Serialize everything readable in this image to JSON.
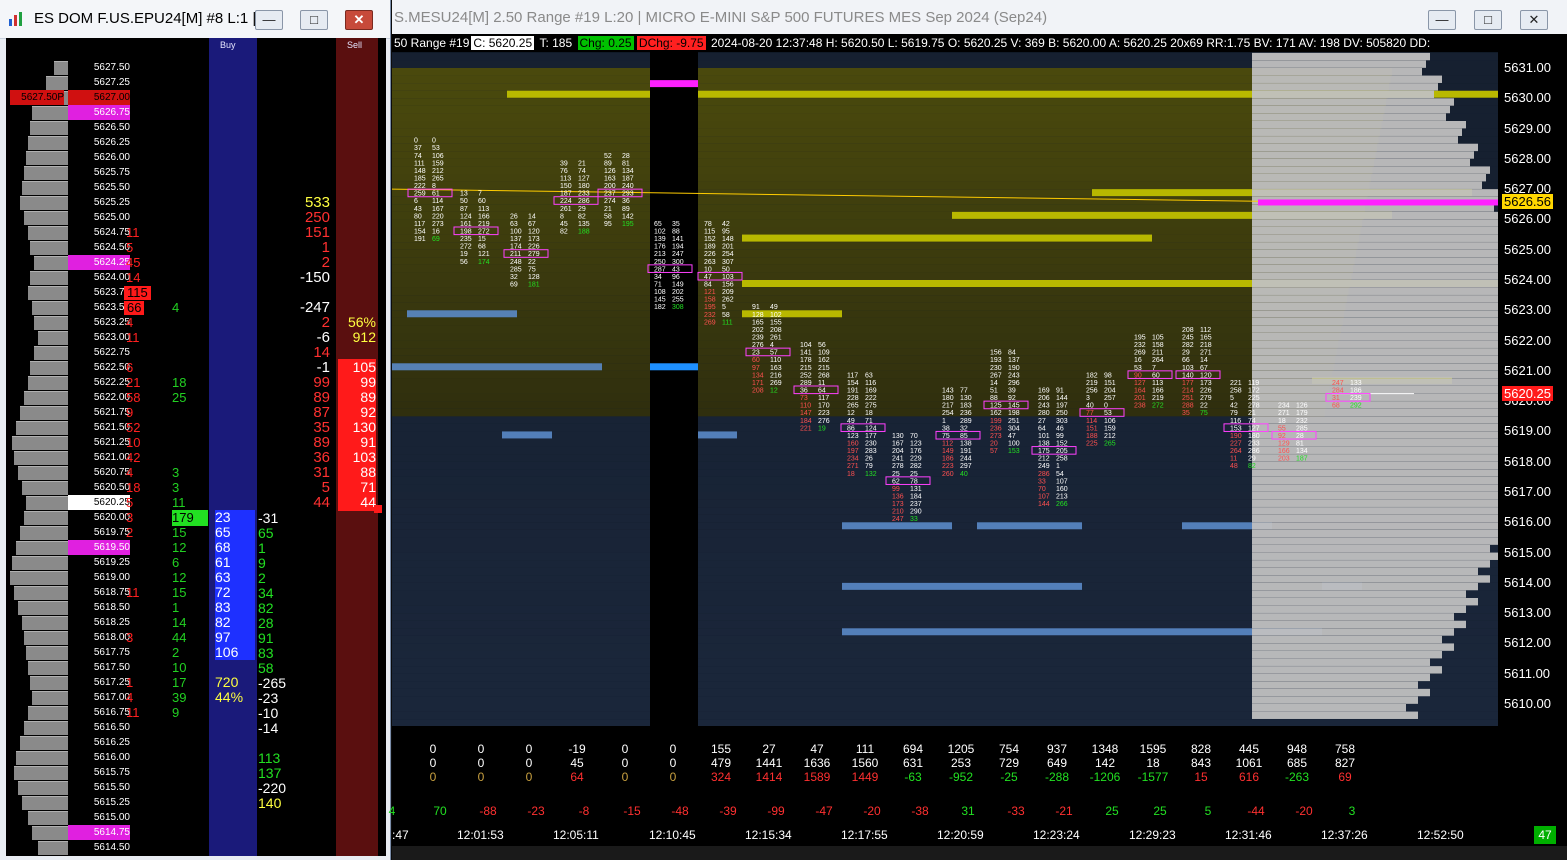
{
  "dom_window": {
    "title": "ES DOM F.US.EPU24[M] #8 L:1 |...",
    "buy_header": "Buy",
    "sell_header": "Sell",
    "rows": [
      {
        "price": "5627.50",
        "style": ""
      },
      {
        "price": "5627.25",
        "style": ""
      },
      {
        "price": "5627.00",
        "style": "redbg",
        "left_label": "5627.50P"
      },
      {
        "price": "5626.75",
        "style": "mag"
      },
      {
        "price": "5626.50",
        "style": ""
      },
      {
        "price": "5626.25",
        "style": ""
      },
      {
        "price": "5626.00",
        "style": ""
      },
      {
        "price": "5625.75",
        "style": ""
      },
      {
        "price": "5625.50",
        "style": ""
      },
      {
        "price": "5625.25",
        "style": ""
      },
      {
        "price": "5625.00",
        "style": ""
      },
      {
        "price": "5624.75",
        "style": "",
        "ask": "11"
      },
      {
        "price": "5624.50",
        "style": "",
        "ask": "5"
      },
      {
        "price": "5624.25",
        "style": "mag",
        "ask": "45"
      },
      {
        "price": "5624.00",
        "style": "",
        "ask": "14"
      },
      {
        "price": "5623.75",
        "style": "",
        "ask": "115",
        "ask_hl": true
      },
      {
        "price": "5623.50",
        "style": "",
        "ask": "66",
        "ask_hl": true,
        "bid": "4"
      },
      {
        "price": "5623.25",
        "style": "",
        "ask": "4"
      },
      {
        "price": "5623.00",
        "style": "",
        "ask": "11"
      },
      {
        "price": "5622.75",
        "style": ""
      },
      {
        "price": "5622.50",
        "style": "",
        "ask": "6"
      },
      {
        "price": "5622.25",
        "style": "",
        "ask": "21",
        "bid": "18"
      },
      {
        "price": "5622.00",
        "style": "",
        "ask": "58",
        "bid": "25"
      },
      {
        "price": "5621.75",
        "style": "",
        "ask": "9"
      },
      {
        "price": "5621.50",
        "style": "",
        "ask": "52"
      },
      {
        "price": "5621.25",
        "style": "",
        "ask": "10"
      },
      {
        "price": "5621.00",
        "style": "",
        "ask": "42"
      },
      {
        "price": "5620.75",
        "style": "",
        "ask": "4",
        "bid": "3"
      },
      {
        "price": "5620.50",
        "style": "",
        "ask": "18",
        "bid": "3"
      },
      {
        "price": "5620.25",
        "style": "cur",
        "ask": "5",
        "bid": "11"
      },
      {
        "price": "5620.00",
        "style": "",
        "ask": "3",
        "bid": "179",
        "bid_hl": true
      },
      {
        "price": "5619.75",
        "style": "",
        "ask": "2",
        "bid": "15"
      },
      {
        "price": "5619.50",
        "style": "mag",
        "bid": "12"
      },
      {
        "price": "5619.25",
        "style": "",
        "bid": "6"
      },
      {
        "price": "5619.00",
        "style": "",
        "bid": "12"
      },
      {
        "price": "5618.75",
        "style": "",
        "ask": "11",
        "bid": "15"
      },
      {
        "price": "5618.50",
        "style": "",
        "bid": "1"
      },
      {
        "price": "5618.25",
        "style": "",
        "bid": "14"
      },
      {
        "price": "5618.00",
        "style": "",
        "ask": "3",
        "bid": "44"
      },
      {
        "price": "5617.75",
        "style": "",
        "bid": "2"
      },
      {
        "price": "5617.50",
        "style": "",
        "bid": "10"
      },
      {
        "price": "5617.25",
        "style": "",
        "ask": "1",
        "bid": "17"
      },
      {
        "price": "5617.00",
        "style": "",
        "ask": "4",
        "bid": "39"
      },
      {
        "price": "5616.75",
        "style": "",
        "ask": "11",
        "bid": "9"
      },
      {
        "price": "5616.50",
        "style": ""
      },
      {
        "price": "5616.25",
        "style": ""
      },
      {
        "price": "5616.00",
        "style": ""
      },
      {
        "price": "5615.75",
        "style": ""
      },
      {
        "price": "5615.50",
        "style": ""
      },
      {
        "price": "5615.25",
        "style": ""
      },
      {
        "price": "5615.00",
        "style": ""
      },
      {
        "price": "5614.75",
        "style": "mag"
      },
      {
        "price": "5614.50",
        "style": ""
      }
    ],
    "volume_profile": [
      14,
      22,
      32,
      36,
      38,
      40,
      42,
      44,
      46,
      48,
      44,
      40,
      38,
      34,
      38,
      40,
      36,
      34,
      30,
      34,
      38,
      40,
      44,
      48,
      52,
      56,
      54,
      50,
      46,
      42,
      44,
      48,
      52,
      56,
      58,
      54,
      50,
      46,
      44,
      42,
      40,
      38,
      36,
      40,
      44,
      48,
      52,
      54,
      50,
      46,
      40,
      36,
      30
    ],
    "buy_values": [
      {
        "row": 30,
        "text": "23",
        "hl": true
      },
      {
        "row": 31,
        "text": "65",
        "hl": true
      },
      {
        "row": 32,
        "text": "68",
        "hl": true
      },
      {
        "row": 33,
        "text": "61",
        "hl": true
      },
      {
        "row": 34,
        "text": "63",
        "hl": true
      },
      {
        "row": 35,
        "text": "72",
        "hl": true
      },
      {
        "row": 36,
        "text": "83",
        "hl": true
      },
      {
        "row": 37,
        "text": "82",
        "hl": true
      },
      {
        "row": 38,
        "text": "97",
        "hl": true
      },
      {
        "row": 39,
        "text": "106",
        "hl": true
      },
      {
        "row": 41,
        "text": "720",
        "hl": false,
        "color": "#ffff40"
      },
      {
        "row": 42,
        "text": "44%",
        "hl": false,
        "color": "#ffff40"
      }
    ],
    "net_values": [
      {
        "row": 30,
        "text": "-31",
        "color": "#ffffff"
      },
      {
        "row": 31,
        "text": "65",
        "color": "#22e022"
      },
      {
        "row": 32,
        "text": "1",
        "color": "#22e022"
      },
      {
        "row": 33,
        "text": "9",
        "color": "#22e022"
      },
      {
        "row": 34,
        "text": "2",
        "color": "#22e022"
      },
      {
        "row": 35,
        "text": "34",
        "color": "#22e022"
      },
      {
        "row": 36,
        "text": "82",
        "color": "#22e022"
      },
      {
        "row": 37,
        "text": "28",
        "color": "#22e022"
      },
      {
        "row": 38,
        "text": "91",
        "color": "#22e022"
      },
      {
        "row": 39,
        "text": "83",
        "color": "#22e022"
      },
      {
        "row": 40,
        "text": "58",
        "color": "#22e022"
      },
      {
        "row": 41,
        "text": "-265",
        "color": "#ffffff"
      },
      {
        "row": 42,
        "text": "-23",
        "color": "#ffffff"
      },
      {
        "row": 43,
        "text": "-10",
        "color": "#ffffff"
      },
      {
        "row": 44,
        "text": "-14",
        "color": "#ffffff"
      },
      {
        "row": 46,
        "text": "113",
        "color": "#22e022"
      },
      {
        "row": 47,
        "text": "137",
        "color": "#22e022"
      },
      {
        "row": 48,
        "text": "-220",
        "color": "#ffffff"
      },
      {
        "row": 49,
        "text": "140",
        "color": "#ffff40"
      }
    ],
    "side_values": [
      {
        "row": 9,
        "text": "533",
        "color": "#ffff40"
      },
      {
        "row": 10,
        "text": "250",
        "color": "#ff3030"
      },
      {
        "row": 11,
        "text": "151",
        "color": "#ff3030"
      },
      {
        "row": 12,
        "text": "1",
        "color": "#ff3030"
      },
      {
        "row": 13,
        "text": "2",
        "color": "#ff3030"
      },
      {
        "row": 14,
        "text": "-150",
        "color": "#ffffff"
      },
      {
        "row": 16,
        "text": "-247",
        "color": "#ffffff"
      },
      {
        "row": 17,
        "text": "2",
        "color": "#ff3030"
      },
      {
        "row": 18,
        "text": "-6",
        "color": "#ffffff"
      },
      {
        "row": 19,
        "text": "14",
        "color": "#ff3030"
      },
      {
        "row": 20,
        "text": "-1",
        "color": "#ffffff"
      },
      {
        "row": 21,
        "text": "99",
        "color": "#ff3030"
      },
      {
        "row": 22,
        "text": "89",
        "color": "#ff3030"
      },
      {
        "row": 23,
        "text": "87",
        "color": "#ff3030"
      },
      {
        "row": 24,
        "text": "35",
        "color": "#ff3030"
      },
      {
        "row": 25,
        "text": "89",
        "color": "#ff3030"
      },
      {
        "row": 26,
        "text": "36",
        "color": "#ff3030"
      },
      {
        "row": 27,
        "text": "31",
        "color": "#ff3030"
      },
      {
        "row": 28,
        "text": "5",
        "color": "#ff3030"
      },
      {
        "row": 29,
        "text": "44",
        "color": "#ff3030"
      }
    ],
    "sell_values": [
      {
        "row": 17,
        "text": "56%",
        "color": "#ffff40",
        "hl": false
      },
      {
        "row": 18,
        "text": "912",
        "color": "#ffff40",
        "hl": false
      },
      {
        "row": 20,
        "text": "105",
        "color": "#ffffff",
        "hl": true
      },
      {
        "row": 21,
        "text": "99",
        "color": "#ffffff",
        "hl": true
      },
      {
        "row": 22,
        "text": "89",
        "color": "#ffffff",
        "hl": true
      },
      {
        "row": 23,
        "text": "92",
        "color": "#ffffff",
        "hl": true
      },
      {
        "row": 24,
        "text": "130",
        "color": "#ffffff",
        "hl": true
      },
      {
        "row": 25,
        "text": "91",
        "color": "#ffffff",
        "hl": true
      },
      {
        "row": 26,
        "text": "103",
        "color": "#ffffff",
        "hl": true
      },
      {
        "row": 27,
        "text": "88",
        "color": "#ffffff",
        "hl": true
      },
      {
        "row": 28,
        "text": "71",
        "color": "#ffffff",
        "hl": true
      },
      {
        "row": 29,
        "text": "44",
        "color": "#ffffff",
        "hl": true
      }
    ]
  },
  "chart_window": {
    "title": "S.MESU24[M]  2.50 Range #19 L:20 | MICRO E-MINI S&P 500 FUTURES MES Sep 2024 (Sep24)",
    "info": {
      "prefix": "50 Range #19",
      "c": "C: 5620.25",
      "t": "T: 185",
      "chg": "Chg: 0.25",
      "dchg": "DChg: -9.75",
      "rest": "2024-08-20  12:37:48  H: 5620.50  L: 5619.75  O: 5620.25  V: 369  B: 5620.00  A: 5620.25  20x69  RR:1.75  BV: 171  AV: 198  DV: 505820  DD:"
    },
    "price_axis": {
      "labels": [
        "5631.00",
        "5630.00",
        "5629.00",
        "5628.00",
        "5627.00",
        "5626.00",
        "5625.00",
        "5624.00",
        "5623.00",
        "5622.00",
        "5621.00",
        "5620.00",
        "5619.00",
        "5618.00",
        "5617.00",
        "5616.00",
        "5615.00",
        "5614.00",
        "5613.00",
        "5612.00",
        "5611.00",
        "5610.00"
      ],
      "current": "5620.25",
      "marker": "5626.56"
    },
    "stats_row1": [
      "0",
      "0",
      "0",
      "-19",
      "0",
      "0",
      "155",
      "27",
      "47",
      "111",
      "694",
      "1205",
      "754",
      "937",
      "1348",
      "1595",
      "828",
      "445",
      "948",
      "758"
    ],
    "stats_row2": [
      "0",
      "0",
      "0",
      "45",
      "0",
      "0",
      "479",
      "1441",
      "1636",
      "1560",
      "631",
      "253",
      "729",
      "649",
      "142",
      "18",
      "843",
      "1061",
      "685",
      "827"
    ],
    "stats_row3": [
      {
        "v": "0",
        "c": "#c8a040"
      },
      {
        "v": "0",
        "c": "#c8a040"
      },
      {
        "v": "0",
        "c": "#c8a040"
      },
      {
        "v": "64",
        "c": "#ff3030"
      },
      {
        "v": "0",
        "c": "#c8a040"
      },
      {
        "v": "0",
        "c": "#c8a040"
      },
      {
        "v": "324",
        "c": "#ff3030"
      },
      {
        "v": "1414",
        "c": "#ff3030"
      },
      {
        "v": "1589",
        "c": "#ff3030"
      },
      {
        "v": "1449",
        "c": "#ff3030"
      },
      {
        "v": "-63",
        "c": "#22e022"
      },
      {
        "v": "-952",
        "c": "#22e022"
      },
      {
        "v": "-25",
        "c": "#22e022"
      },
      {
        "v": "-288",
        "c": "#22e022"
      },
      {
        "v": "-1206",
        "c": "#22e022"
      },
      {
        "v": "-1577",
        "c": "#22e022"
      },
      {
        "v": "15",
        "c": "#ff3030"
      },
      {
        "v": "616",
        "c": "#ff3030"
      },
      {
        "v": "-263",
        "c": "#22e022"
      },
      {
        "v": "69",
        "c": "#ff3030"
      }
    ],
    "stats_row4": [
      {
        "v": "4",
        "c": "#22e022"
      },
      {
        "v": "70",
        "c": "#22e022"
      },
      {
        "v": "-88",
        "c": "#ff3030"
      },
      {
        "v": "-23",
        "c": "#ff3030"
      },
      {
        "v": "-8",
        "c": "#ff3030"
      },
      {
        "v": "-15",
        "c": "#ff3030"
      },
      {
        "v": "-48",
        "c": "#ff3030"
      },
      {
        "v": "-39",
        "c": "#ff3030"
      },
      {
        "v": "-99",
        "c": "#ff3030"
      },
      {
        "v": "-47",
        "c": "#ff3030"
      },
      {
        "v": "-20",
        "c": "#ff3030"
      },
      {
        "v": "-38",
        "c": "#ff3030"
      },
      {
        "v": "31",
        "c": "#22e022"
      },
      {
        "v": "-33",
        "c": "#ff3030"
      },
      {
        "v": "-21",
        "c": "#ff3030"
      },
      {
        "v": "25",
        "c": "#22e022"
      },
      {
        "v": "25",
        "c": "#22e022"
      },
      {
        "v": "5",
        "c": "#22e022"
      },
      {
        "v": "-44",
        "c": "#ff3030"
      },
      {
        "v": "-20",
        "c": "#ff3030"
      },
      {
        "v": "3",
        "c": "#22e022"
      }
    ],
    "time_labels": [
      ":47",
      "12:01:53",
      "12:05:11",
      "12:10:45",
      "12:15:34",
      "12:17:55",
      "12:20:59",
      "12:23:24",
      "12:29:23",
      "12:31:46",
      "12:37:26",
      "12:52:50"
    ],
    "badge": "47",
    "colors": {
      "bg": "#101a26",
      "yellow_band": "#c8c800",
      "magenta": "#ff20ff",
      "blue": "#6aa0e0",
      "profile": "#c0c0c0"
    }
  }
}
